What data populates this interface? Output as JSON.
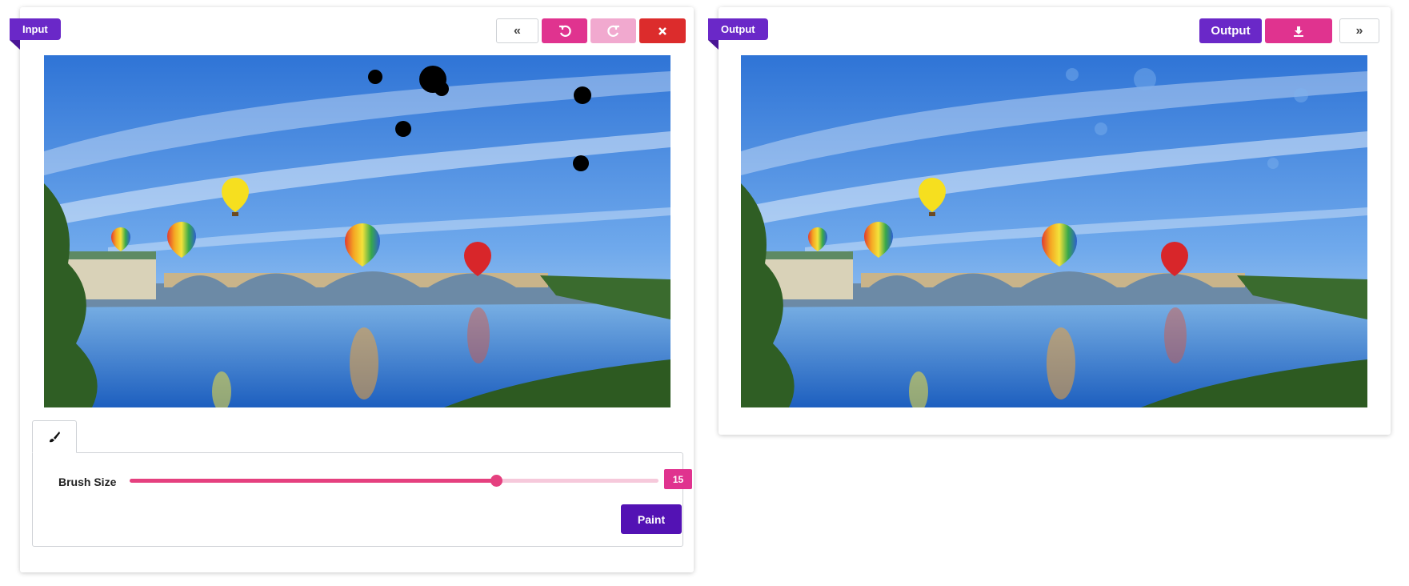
{
  "input_panel": {
    "ribbon_label": "Input",
    "toolbar": [
      {
        "name": "prev-button",
        "icon": "double-chevron-left-icon",
        "glyph": "«"
      },
      {
        "name": "undo-button",
        "icon": "undo-icon"
      },
      {
        "name": "redo-button",
        "icon": "redo-icon"
      },
      {
        "name": "clear-button",
        "icon": "close-icon"
      }
    ],
    "tab": {
      "icon": "brush-icon"
    },
    "brush": {
      "label": "Brush Size",
      "value": "15",
      "fraction": 0.74
    },
    "paint_button": "Paint"
  },
  "output_panel": {
    "ribbon_label": "Output",
    "output_button": "Output",
    "toolbar": [
      {
        "name": "download-button",
        "icon": "download-icon"
      },
      {
        "name": "next-button",
        "icon": "double-chevron-right-icon",
        "glyph": "»"
      }
    ]
  },
  "colors": {
    "accent_purple": "#6a28c8",
    "accent_pink": "#e0338f",
    "accent_red": "#dc2c2c",
    "paint_purple": "#5312b4"
  }
}
